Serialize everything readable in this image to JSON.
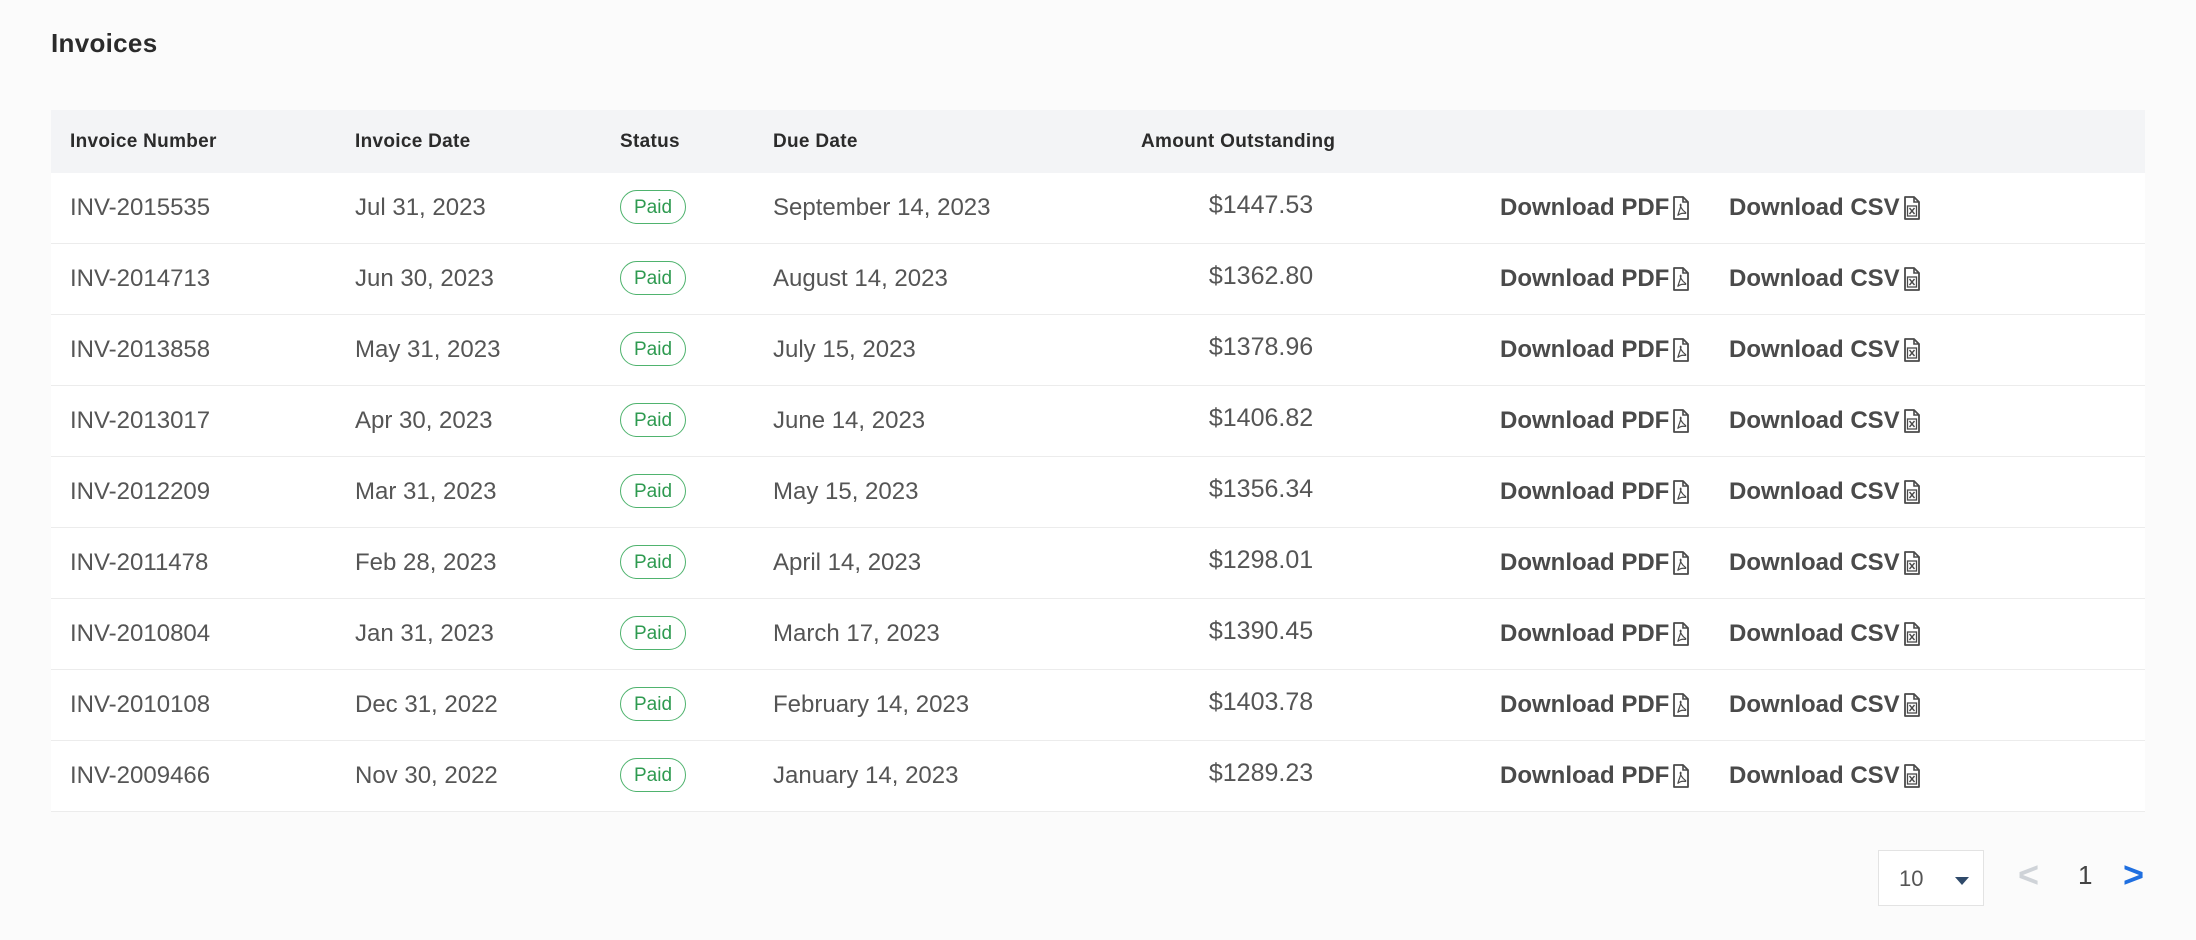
{
  "page": {
    "title": "Invoices"
  },
  "table": {
    "headers": {
      "invoice_number": "Invoice Number",
      "invoice_date": "Invoice Date",
      "status": "Status",
      "due_date": "Due Date",
      "amount_outstanding": "Amount Outstanding"
    },
    "rows": [
      {
        "invoice_number": "INV-2015535",
        "invoice_date": "Jul 31, 2023",
        "status": "Paid",
        "due_date": "September 14, 2023",
        "amount": "$1447.53",
        "pdf_label": "Download PDF",
        "csv_label": "Download CSV"
      },
      {
        "invoice_number": "INV-2014713",
        "invoice_date": "Jun 30, 2023",
        "status": "Paid",
        "due_date": "August 14, 2023",
        "amount": "$1362.80",
        "pdf_label": "Download PDF",
        "csv_label": "Download CSV"
      },
      {
        "invoice_number": "INV-2013858",
        "invoice_date": "May 31, 2023",
        "status": "Paid",
        "due_date": "July 15, 2023",
        "amount": "$1378.96",
        "pdf_label": "Download PDF",
        "csv_label": "Download CSV"
      },
      {
        "invoice_number": "INV-2013017",
        "invoice_date": "Apr 30, 2023",
        "status": "Paid",
        "due_date": "June 14, 2023",
        "amount": "$1406.82",
        "pdf_label": "Download PDF",
        "csv_label": "Download CSV"
      },
      {
        "invoice_number": "INV-2012209",
        "invoice_date": "Mar 31, 2023",
        "status": "Paid",
        "due_date": "May 15, 2023",
        "amount": "$1356.34",
        "pdf_label": "Download PDF",
        "csv_label": "Download CSV"
      },
      {
        "invoice_number": "INV-2011478",
        "invoice_date": "Feb 28, 2023",
        "status": "Paid",
        "due_date": "April 14, 2023",
        "amount": "$1298.01",
        "pdf_label": "Download PDF",
        "csv_label": "Download CSV"
      },
      {
        "invoice_number": "INV-2010804",
        "invoice_date": "Jan 31, 2023",
        "status": "Paid",
        "due_date": "March 17, 2023",
        "amount": "$1390.45",
        "pdf_label": "Download PDF",
        "csv_label": "Download CSV"
      },
      {
        "invoice_number": "INV-2010108",
        "invoice_date": "Dec 31, 2022",
        "status": "Paid",
        "due_date": "February 14, 2023",
        "amount": "$1403.78",
        "pdf_label": "Download PDF",
        "csv_label": "Download CSV"
      },
      {
        "invoice_number": "INV-2009466",
        "invoice_date": "Nov 30, 2022",
        "status": "Paid",
        "due_date": "January 14, 2023",
        "amount": "$1289.23",
        "pdf_label": "Download PDF",
        "csv_label": "Download CSV"
      }
    ],
    "icons": {
      "pdf": "file-pdf-icon",
      "csv": "file-csv-icon"
    }
  },
  "pagination": {
    "page_size": "10",
    "prev_label": "<",
    "current_page": "1",
    "next_label": ">"
  },
  "colors": {
    "status_paid": "#2e9a50",
    "pager_active": "#1f6fe0",
    "pager_disabled": "#cfd3d8",
    "header_bg": "#f3f4f6"
  }
}
